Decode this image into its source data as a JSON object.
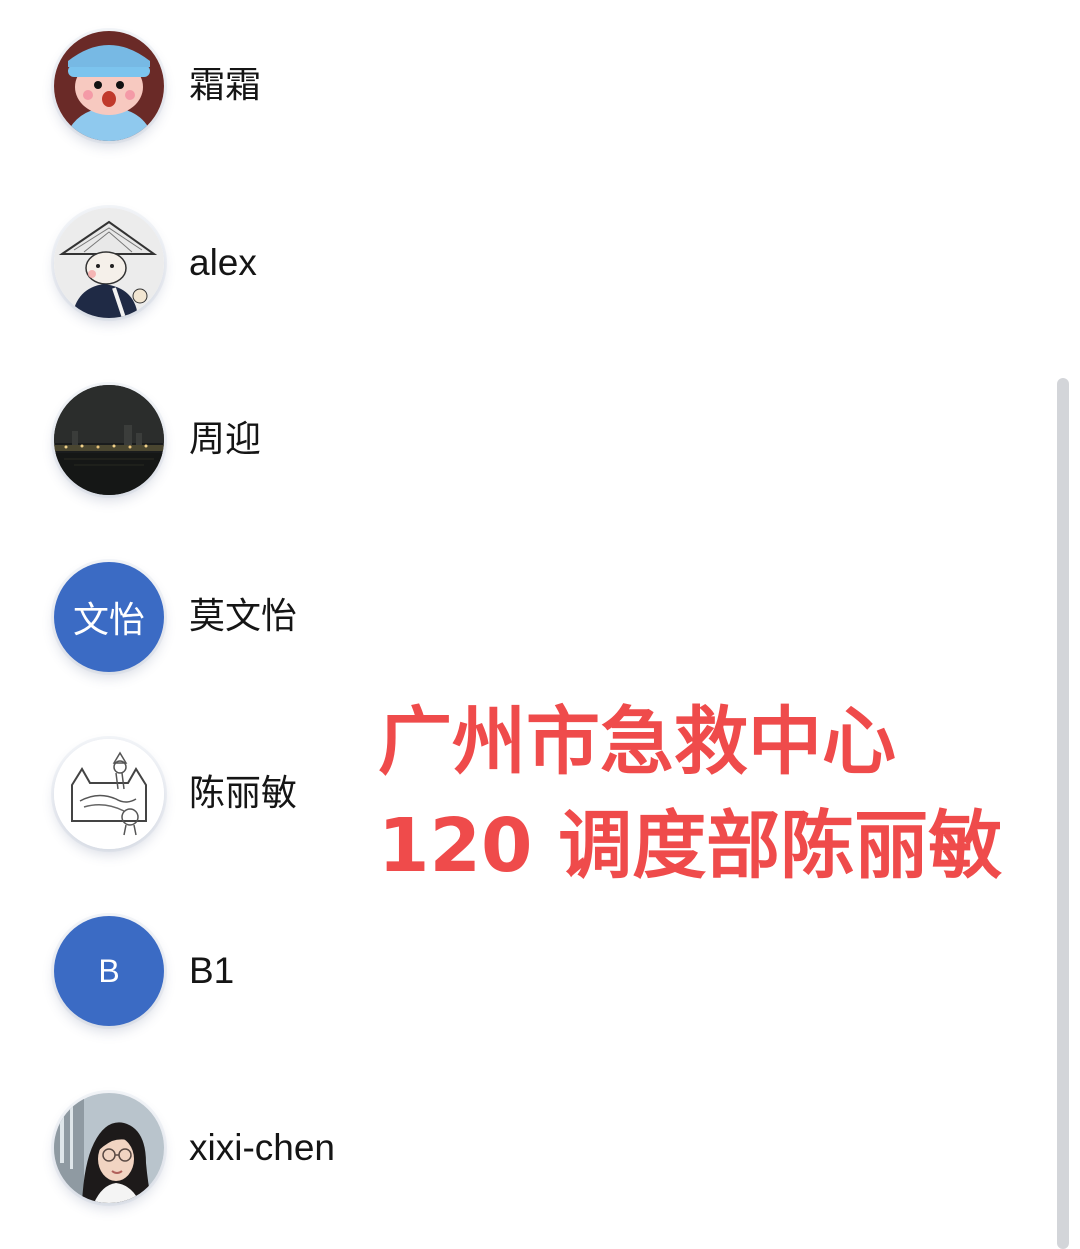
{
  "contacts": [
    {
      "name": "霜霜",
      "avatar": "cartoon-girl-avatar"
    },
    {
      "name": "alex",
      "avatar": "sketch-monk-avatar"
    },
    {
      "name": "周迎",
      "avatar": "night-city-avatar"
    },
    {
      "name": "莫文怡",
      "avatar_text": "文怡",
      "avatar_color": "#3b6bc4"
    },
    {
      "name": "陈丽敏",
      "avatar": "sketch-cats-avatar"
    },
    {
      "name": "B1",
      "avatar_text": "B",
      "avatar_color": "#3b6bc4"
    },
    {
      "name": "xixi-chen",
      "avatar": "portrait-photo-avatar"
    }
  ],
  "overlay": {
    "line1": "广州市急救中心",
    "line2": "120 调度部陈丽敏",
    "color": "#ef4b4b"
  }
}
